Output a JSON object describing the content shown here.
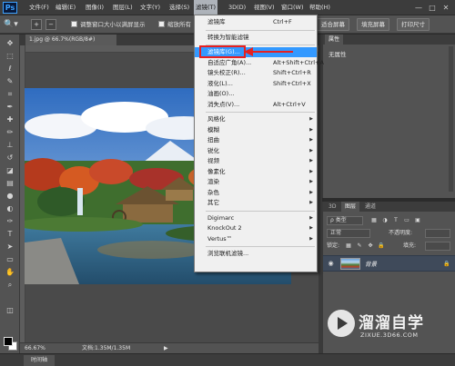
{
  "app": {
    "logo": "Ps"
  },
  "menubar": {
    "items": [
      "文件(F)",
      "编辑(E)",
      "图像(I)",
      "图层(L)",
      "文字(Y)",
      "选择(S)",
      "滤镜(T)",
      "3D(D)",
      "视图(V)",
      "窗口(W)",
      "帮助(H)"
    ],
    "active_index": 6,
    "window_controls": [
      "—",
      "□",
      "✕"
    ]
  },
  "options": {
    "checkbox_label": "调整窗口大小以满屏显示",
    "truncated_label": "缩放所有",
    "buttons": [
      "适合屏幕",
      "填充屏幕",
      "打印尺寸"
    ]
  },
  "document": {
    "tab_title": "1.jpg @ 66.7%(RGB/8#)"
  },
  "status": {
    "zoom": "66.67%",
    "doc_size": "文档:1.35M/1.35M",
    "arrow": "▶"
  },
  "timeline": {
    "label": "时间轴"
  },
  "properties": {
    "tab": "属性",
    "content": "无属性"
  },
  "layers": {
    "tabs": [
      "3D",
      "图层",
      "通道"
    ],
    "kind_label": "ρ 类型",
    "blend_mode": "正常",
    "opacity_label": "不透明度:",
    "lock_label": "锁定:",
    "fill_label": "填充:",
    "layer_name": "背景"
  },
  "filter_menu": {
    "items": [
      {
        "label": "滤镜库",
        "shortcut": "Ctrl+F",
        "arrow": false
      },
      {
        "sep": true
      },
      {
        "label": "转换为智能滤镜",
        "shortcut": "",
        "arrow": false
      },
      {
        "sep": true
      },
      {
        "label": "滤镜库(G)...",
        "shortcut": "",
        "arrow": false,
        "highlight": true
      },
      {
        "label": "自适应广角(A)...",
        "shortcut": "Alt+Shift+Ctrl+A",
        "arrow": false
      },
      {
        "label": "镜头校正(R)...",
        "shortcut": "Shift+Ctrl+R",
        "arrow": false
      },
      {
        "label": "液化(L)...",
        "shortcut": "Shift+Ctrl+X",
        "arrow": false
      },
      {
        "label": "油画(O)...",
        "shortcut": "",
        "arrow": false
      },
      {
        "label": "消失点(V)...",
        "shortcut": "Alt+Ctrl+V",
        "arrow": false
      },
      {
        "sep": true
      },
      {
        "label": "风格化",
        "shortcut": "",
        "arrow": true
      },
      {
        "label": "模糊",
        "shortcut": "",
        "arrow": true
      },
      {
        "label": "扭曲",
        "shortcut": "",
        "arrow": true
      },
      {
        "label": "锐化",
        "shortcut": "",
        "arrow": true
      },
      {
        "label": "视频",
        "shortcut": "",
        "arrow": true
      },
      {
        "label": "像素化",
        "shortcut": "",
        "arrow": true
      },
      {
        "label": "渲染",
        "shortcut": "",
        "arrow": true
      },
      {
        "label": "杂色",
        "shortcut": "",
        "arrow": true
      },
      {
        "label": "其它",
        "shortcut": "",
        "arrow": true
      },
      {
        "sep": true
      },
      {
        "label": "Digimarc",
        "shortcut": "",
        "arrow": true
      },
      {
        "label": "KnockOut 2",
        "shortcut": "",
        "arrow": true
      },
      {
        "label": "Vertus™",
        "shortcut": "",
        "arrow": true
      },
      {
        "sep": true
      },
      {
        "label": "浏览联机滤镜...",
        "shortcut": "",
        "arrow": false
      }
    ]
  },
  "watermark": {
    "title": "溜溜自学",
    "url": "ZIXUE.3D66.COM"
  },
  "colors": {
    "highlight": "#3399ff",
    "annotation": "#e62020"
  }
}
